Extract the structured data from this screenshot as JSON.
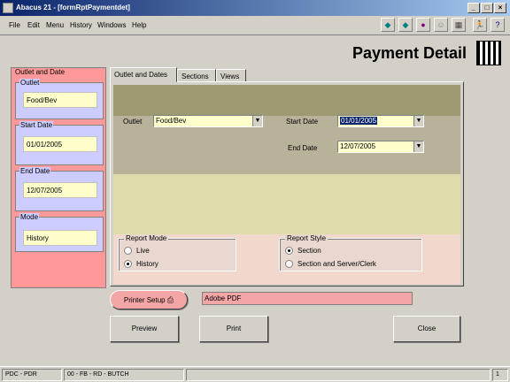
{
  "window": {
    "title": "Abacus 21 - [formRptPaymentdet]",
    "controls": [
      "_",
      "□",
      "×"
    ]
  },
  "menu": [
    "File",
    "Edit",
    "Menu",
    "History",
    "Windows",
    "Help"
  ],
  "toolbar": [
    "arrow-left-icon",
    "arrow-right-icon",
    "print-icon",
    "user-icon",
    "calculator-icon",
    "exit-icon",
    "help-icon"
  ],
  "heading": "Payment Detail",
  "left_panel": {
    "title": "Outlet and Date",
    "outlet": {
      "label": "Outlet",
      "value": "Food/Bev"
    },
    "start_date": {
      "label": "Start Date",
      "value": "01/01/2005"
    },
    "end_date": {
      "label": "End Date",
      "value": "12/07/2005"
    },
    "mode": {
      "label": "Mode",
      "value": "History"
    }
  },
  "tabs": [
    "Outlet and Dates",
    "Sections",
    "Views"
  ],
  "form": {
    "outlet_label": "Outlet",
    "outlet_value": "Food/Bev",
    "start_date_label": "Start Date",
    "start_date_value": "01/01/2005",
    "end_date_label": "End Date",
    "end_date_value": "12/07/2005"
  },
  "report_mode": {
    "label": "Report Mode",
    "options": [
      "Live",
      "History"
    ],
    "selected": "History"
  },
  "report_style": {
    "label": "Report Style",
    "options": [
      "Section",
      "Section and Server/Clerk"
    ],
    "selected": "Section"
  },
  "printer": {
    "button_label": "Printer Setup",
    "value": "Adobe PDF"
  },
  "actions": {
    "preview": "Preview",
    "print": "Print",
    "close": "Close"
  },
  "status": {
    "left": "PDC - PDR",
    "middle": "00 - FB - RD - BUTCH",
    "page": "1"
  },
  "colors": {
    "titlebar_start": "#0a246a",
    "panel_pink": "#ff9999",
    "field_yellow": "#ffffcc",
    "band_olive": "#9c9a70",
    "band_tan": "#b8b29a",
    "band_green": "#dedcaa",
    "band_pink": "#f2d8cc"
  }
}
